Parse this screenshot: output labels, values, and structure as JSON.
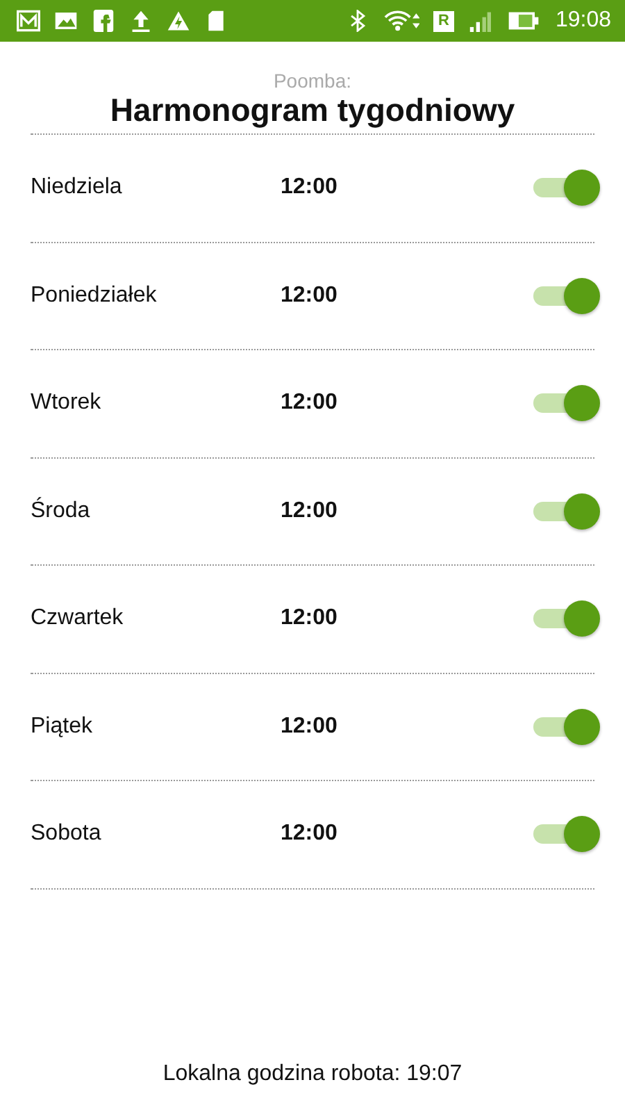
{
  "status_bar": {
    "time": "19:08",
    "network_badge": "R"
  },
  "header": {
    "subtitle": "Poomba:",
    "title": "Harmonogram tygodniowy"
  },
  "schedule": [
    {
      "day": "Niedziela",
      "time": "12:00",
      "on": true
    },
    {
      "day": "Poniedziałek",
      "time": "12:00",
      "on": true
    },
    {
      "day": "Wtorek",
      "time": "12:00",
      "on": true
    },
    {
      "day": "Środa",
      "time": "12:00",
      "on": true
    },
    {
      "day": "Czwartek",
      "time": "12:00",
      "on": true
    },
    {
      "day": "Piątek",
      "time": "12:00",
      "on": true
    },
    {
      "day": "Sobota",
      "time": "12:00",
      "on": true
    }
  ],
  "footer": "Lokalna godzina robota: 19:07"
}
